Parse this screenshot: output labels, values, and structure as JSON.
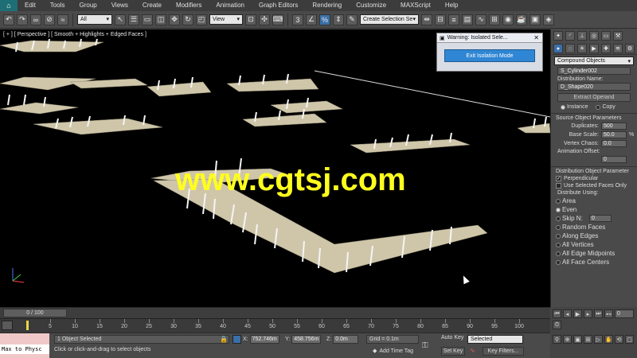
{
  "menubar": {
    "items": [
      "Edit",
      "Tools",
      "Group",
      "Views",
      "Create",
      "Modifiers",
      "Animation",
      "Graph Editors",
      "Rendering",
      "Customize",
      "MAXScript",
      "Help"
    ]
  },
  "toolbar": {
    "filter_select": "All",
    "view_select": "View",
    "selection_set_select": "Create Selection Se"
  },
  "viewport": {
    "label": "[ + ] [ Perspective ] [ Smooth + Highlights + Edged Faces ]",
    "watermark": "www.cgtsj.com"
  },
  "isolation_dialog": {
    "title": "Warning: Isolated Sele...",
    "button": "Exit Isolation Mode"
  },
  "command_panel": {
    "category": "Compound Objects",
    "operand_name": "S_Cylinder002",
    "distribution_name_label": "Distribution Name:",
    "distribution_name": "D_Shape020",
    "extract_operand": "Extract Operand",
    "instance_label": "Instance",
    "copy_label": "Copy",
    "source_params_title": "Source Object Parameters",
    "duplicates_label": "Duplicates:",
    "duplicates_value": "500",
    "base_scale_label": "Base Scale:",
    "base_scale_value": "50.0",
    "base_scale_unit": "%",
    "vertex_chaos_label": "Vertex Chaos:",
    "vertex_chaos_value": "0.0",
    "anim_offset_label": "Animation Offset:",
    "anim_offset_value": "0",
    "dist_params_title": "Distribution Object Parameter",
    "perpendicular_label": "Perpendicular",
    "use_selected_label": "Use Selected Faces Only",
    "distribute_using_label": "Distribute Using:",
    "options": [
      "Area",
      "Even",
      "Skip N:",
      "Random Faces",
      "Along Edges",
      "All Vertices",
      "All Edge Midpoints",
      "All Face Centers"
    ],
    "skip_n_value": "0"
  },
  "timeline": {
    "slider_label": "0 / 100",
    "ticks": [
      "5",
      "10",
      "15",
      "20",
      "25",
      "30",
      "35",
      "40",
      "45",
      "50",
      "55",
      "60",
      "65",
      "70",
      "75",
      "80",
      "85",
      "90",
      "95",
      "100"
    ]
  },
  "status": {
    "maxscript": "Max to Physc",
    "selection": "1 Object Selected",
    "prompt": "Click or click-and-drag to select objects",
    "x_label": "X:",
    "x_value": "752.746m",
    "y_label": "Y:",
    "y_value": "458.756m",
    "z_label": "Z:",
    "z_value": "0.0m",
    "grid": "Grid = 0.1m",
    "add_time_tag": "Add Time Tag",
    "auto_key": "Auto Key",
    "set_key": "Set Key",
    "key_mode": "Selected",
    "key_filters": "Key Filters..."
  }
}
